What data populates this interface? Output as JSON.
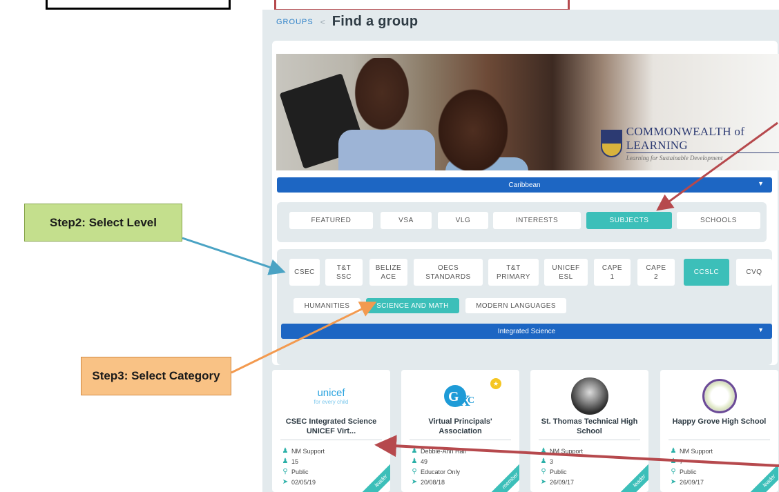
{
  "annotations": {
    "step2": "Step2: Select Level",
    "step3": "Step3: Select Category"
  },
  "breadcrumb": {
    "groups": "GROUPS",
    "sep": "<",
    "title": "Find a group"
  },
  "hero": {
    "org_name": "COMMONWEALTH of LEARNING",
    "org_tagline": "Learning for Sustainable Development",
    "logo_mark": "COL"
  },
  "region_select": {
    "value": "Caribbean"
  },
  "tabs": [
    {
      "label": "FEATURED",
      "active": false
    },
    {
      "label": "VSA",
      "active": false
    },
    {
      "label": "VLG",
      "active": false
    },
    {
      "label": "INTERESTS",
      "active": false
    },
    {
      "label": "SUBJECTS",
      "active": true
    },
    {
      "label": "SCHOOLS",
      "active": false
    }
  ],
  "levels": [
    {
      "label": "CSEC",
      "active": false
    },
    {
      "label": "T&T\nSSC",
      "active": false
    },
    {
      "label": "BELIZE\nACE",
      "active": false
    },
    {
      "label": "OECS\nSTANDARDS",
      "active": false
    },
    {
      "label": "T&T\nPRIMARY",
      "active": false
    },
    {
      "label": "UNICEF\nESL",
      "active": false
    },
    {
      "label": "CAPE\n1",
      "active": false
    },
    {
      "label": "CAPE\n2",
      "active": false
    },
    {
      "label": "CCSLC",
      "active": true
    },
    {
      "label": "CVQ",
      "active": false
    }
  ],
  "categories": [
    {
      "label": "HUMANITIES",
      "active": false
    },
    {
      "label": "SCIENCE AND MATH",
      "active": true
    },
    {
      "label": "MODERN LANGUAGES",
      "active": false
    }
  ],
  "subject_select": {
    "value": "Integrated Science"
  },
  "groups": [
    {
      "title": "CSEC Integrated Science UNICEF Virt...",
      "logo_text": "unicef",
      "logo_sub": "for every child",
      "owner": "NM Support",
      "members": "15",
      "privacy": "Public",
      "date": "02/05/19",
      "role": "leader"
    },
    {
      "title": "Virtual Principals' Association",
      "owner": "Debbie-Ann Hall",
      "members": "49",
      "privacy": "Educator Only",
      "date": "20/08/18",
      "role": "member"
    },
    {
      "title": "St. Thomas Technical High School",
      "owner": "NM Support",
      "members": "3",
      "privacy": "Public",
      "date": "26/09/17",
      "role": "leader"
    },
    {
      "title": "Happy Grove High School",
      "owner": "NM Support",
      "members": "7",
      "privacy": "Public",
      "date": "26/09/17",
      "role": "leader"
    }
  ],
  "colors": {
    "accent_teal": "#3cbfb9",
    "select_blue": "#1d66c3",
    "panel_bg": "#e3eaed",
    "arrow_red": "#b6494d",
    "arrow_blue": "#4aa3c4",
    "arrow_orange": "#f39a4f"
  }
}
